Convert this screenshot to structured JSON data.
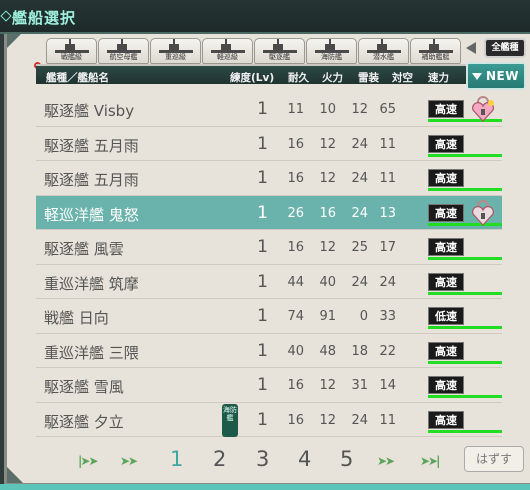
{
  "header": {
    "title": "艦船選択"
  },
  "tabs": [
    {
      "label": "戦艦級"
    },
    {
      "label": "航空母艦"
    },
    {
      "label": "重巡級"
    },
    {
      "label": "軽巡級"
    },
    {
      "label": "駆逐艦"
    },
    {
      "label": "海防艦"
    },
    {
      "label": "潜水艦"
    },
    {
      "label": "補助艦艇"
    }
  ],
  "all_tab": {
    "label": "全艦種"
  },
  "columns": {
    "name": "艦種／艦船名",
    "lv": "練度(Lv)",
    "hp": "耐久",
    "fire": "火力",
    "torpedo": "雷装",
    "aa": "対空",
    "speed": "速力"
  },
  "new_button": {
    "label": "NEW"
  },
  "rows": [
    {
      "name": "駆逐艦 Visby",
      "lv": "1",
      "hp": "11",
      "fire": "10",
      "torpedo": "12",
      "aa": "65",
      "speed": "高速",
      "lock": "locked"
    },
    {
      "name": "駆逐艦 五月雨",
      "lv": "1",
      "hp": "16",
      "fire": "12",
      "torpedo": "24",
      "aa": "11",
      "speed": "高速",
      "lock": ""
    },
    {
      "name": "駆逐艦 五月雨",
      "lv": "1",
      "hp": "16",
      "fire": "12",
      "torpedo": "24",
      "aa": "11",
      "speed": "高速",
      "lock": ""
    },
    {
      "name": "軽巡洋艦 鬼怒",
      "lv": "1",
      "hp": "26",
      "fire": "16",
      "torpedo": "24",
      "aa": "13",
      "speed": "高速",
      "lock": "unlocked"
    },
    {
      "name": "駆逐艦 風雲",
      "lv": "1",
      "hp": "16",
      "fire": "12",
      "torpedo": "25",
      "aa": "17",
      "speed": "高速",
      "lock": ""
    },
    {
      "name": "重巡洋艦 筑摩",
      "lv": "1",
      "hp": "44",
      "fire": "40",
      "torpedo": "24",
      "aa": "24",
      "speed": "高速",
      "lock": ""
    },
    {
      "name": "戦艦 日向",
      "lv": "1",
      "hp": "74",
      "fire": "91",
      "torpedo": "0",
      "aa": "33",
      "speed": "低速",
      "lock": ""
    },
    {
      "name": "重巡洋艦 三隈",
      "lv": "1",
      "hp": "40",
      "fire": "48",
      "torpedo": "18",
      "aa": "22",
      "speed": "高速",
      "lock": ""
    },
    {
      "name": "駆逐艦 雪風",
      "lv": "1",
      "hp": "16",
      "fire": "12",
      "torpedo": "31",
      "aa": "14",
      "speed": "高速",
      "lock": ""
    },
    {
      "name": "駆逐艦 夕立",
      "lv": "1",
      "hp": "16",
      "fire": "12",
      "torpedo": "24",
      "aa": "11",
      "speed": "高速",
      "lock": ""
    }
  ],
  "row_tag": "海防艦",
  "pagination": {
    "pages": [
      "1",
      "2",
      "3",
      "4",
      "5"
    ],
    "current": "1"
  },
  "release_button": {
    "label": "はずす"
  },
  "colors": {
    "accent": "#6ab3ac",
    "header_text": "#9ff0df",
    "gauge": "#22dd22",
    "current_page": "#3fa6a0"
  }
}
